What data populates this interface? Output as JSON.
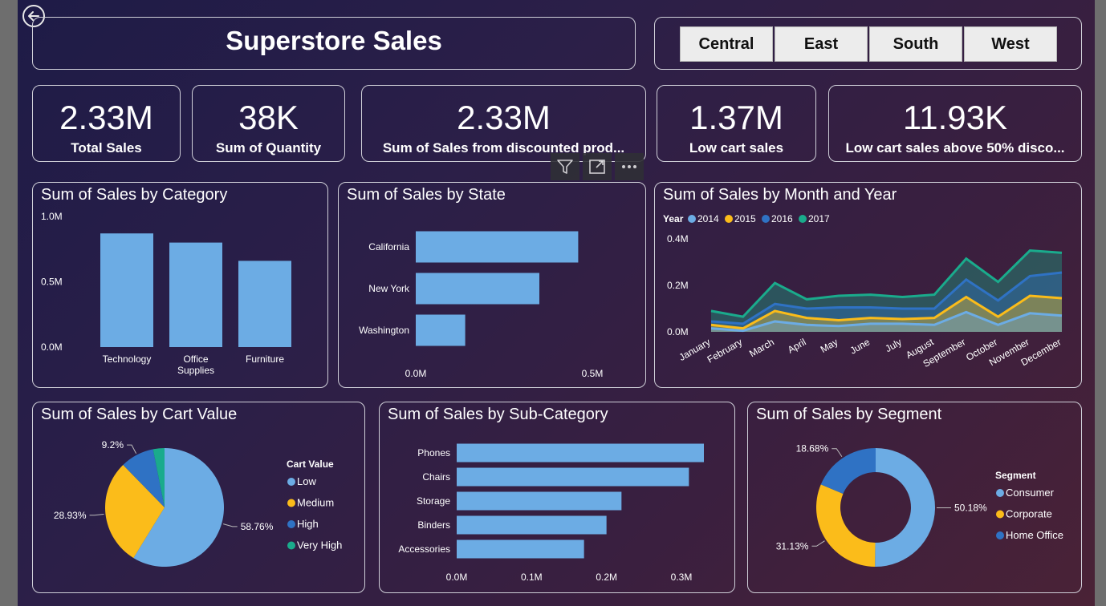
{
  "header": {
    "title": "Superstore Sales",
    "regions": [
      "Central",
      "East",
      "South",
      "West"
    ]
  },
  "kpis": [
    {
      "value": "2.33M",
      "label": "Total Sales"
    },
    {
      "value": "38K",
      "label": "Sum of Quantity"
    },
    {
      "value": "2.33M",
      "label": "Sum of Sales from discounted prod..."
    },
    {
      "value": "1.37M",
      "label": "Low cart sales"
    },
    {
      "value": "11.93K",
      "label": "Low cart sales above 50% disco..."
    }
  ],
  "toolbar": {
    "icons": [
      "filter-icon",
      "focus-mode-icon",
      "more-options-icon"
    ]
  },
  "colors": {
    "blue": "#6cace4",
    "gold": "#fbbc1a",
    "darkblue": "#2f72c4",
    "teal": "#1aab8c"
  },
  "chart_data": [
    {
      "id": "category",
      "type": "bar",
      "title": "Sum of Sales by Category",
      "categories": [
        "Technology",
        "Office Supplies",
        "Furniture"
      ],
      "values": [
        0.87,
        0.8,
        0.66
      ],
      "ylim": [
        0,
        1.0
      ],
      "ticks": [
        "0.0M",
        "0.5M",
        "1.0M"
      ],
      "tick_values": [
        0,
        0.5,
        1.0
      ],
      "grid": false
    },
    {
      "id": "state",
      "type": "bar",
      "orientation": "horizontal",
      "title": "Sum of Sales by State",
      "categories": [
        "California",
        "New York",
        "Washington"
      ],
      "values": [
        0.46,
        0.35,
        0.14
      ],
      "xlim": [
        0,
        0.5
      ],
      "ticks": [
        "0.0M",
        "0.5M"
      ],
      "tick_values": [
        0,
        0.5
      ]
    },
    {
      "id": "month",
      "type": "area",
      "stacked": true,
      "title": "Sum of Sales by Month and Year",
      "legend_title": "Year",
      "legend_position": "top-left",
      "categories": [
        "January",
        "February",
        "March",
        "April",
        "May",
        "June",
        "July",
        "August",
        "September",
        "October",
        "November",
        "December"
      ],
      "series": [
        {
          "name": "2014",
          "color": "#6cace4",
          "values": [
            0.015,
            0.005,
            0.045,
            0.03,
            0.025,
            0.035,
            0.035,
            0.03,
            0.085,
            0.03,
            0.08,
            0.07
          ]
        },
        {
          "name": "2015",
          "color": "#fbbc1a",
          "values": [
            0.015,
            0.01,
            0.045,
            0.03,
            0.025,
            0.025,
            0.02,
            0.03,
            0.065,
            0.035,
            0.075,
            0.075
          ]
        },
        {
          "name": "2016",
          "color": "#2f72c4",
          "values": [
            0.015,
            0.02,
            0.03,
            0.04,
            0.055,
            0.045,
            0.045,
            0.04,
            0.075,
            0.07,
            0.085,
            0.11
          ]
        },
        {
          "name": "2017",
          "color": "#1aab8c",
          "values": [
            0.045,
            0.03,
            0.09,
            0.04,
            0.05,
            0.055,
            0.05,
            0.06,
            0.09,
            0.08,
            0.11,
            0.085
          ]
        }
      ],
      "ylim": [
        0,
        0.4
      ],
      "ticks": [
        "0.0M",
        "0.2M",
        "0.4M"
      ],
      "tick_values": [
        0,
        0.2,
        0.4
      ]
    },
    {
      "id": "cart",
      "type": "pie",
      "title": "Sum of Sales by Cart Value",
      "legend_title": "Cart Value",
      "legend_position": "right",
      "labels": [
        "Low",
        "Medium",
        "High",
        "Very High"
      ],
      "values": [
        58.76,
        28.93,
        9.2,
        3.11
      ],
      "value_labels": [
        "58.76%",
        "28.93%",
        "9.2%",
        ""
      ],
      "colors": [
        "#6cace4",
        "#fbbc1a",
        "#2f72c4",
        "#1aab8c"
      ]
    },
    {
      "id": "subcat",
      "type": "bar",
      "orientation": "horizontal",
      "title": "Sum of Sales by Sub-Category",
      "categories": [
        "Phones",
        "Chairs",
        "Storage",
        "Binders",
        "Accessories"
      ],
      "values": [
        0.33,
        0.31,
        0.22,
        0.2,
        0.17
      ],
      "xlim": [
        0,
        0.3
      ],
      "ticks": [
        "0.0M",
        "0.1M",
        "0.2M",
        "0.3M"
      ],
      "tick_values": [
        0,
        0.1,
        0.2,
        0.3
      ]
    },
    {
      "id": "segment",
      "type": "pie",
      "donut": true,
      "title": "Sum of Sales by Segment",
      "legend_title": "Segment",
      "legend_position": "right",
      "labels": [
        "Consumer",
        "Corporate",
        "Home Office"
      ],
      "values": [
        50.18,
        31.13,
        18.68
      ],
      "value_labels": [
        "50.18%",
        "31.13%",
        "18.68%"
      ],
      "colors": [
        "#6cace4",
        "#fbbc1a",
        "#2f72c4"
      ]
    }
  ]
}
